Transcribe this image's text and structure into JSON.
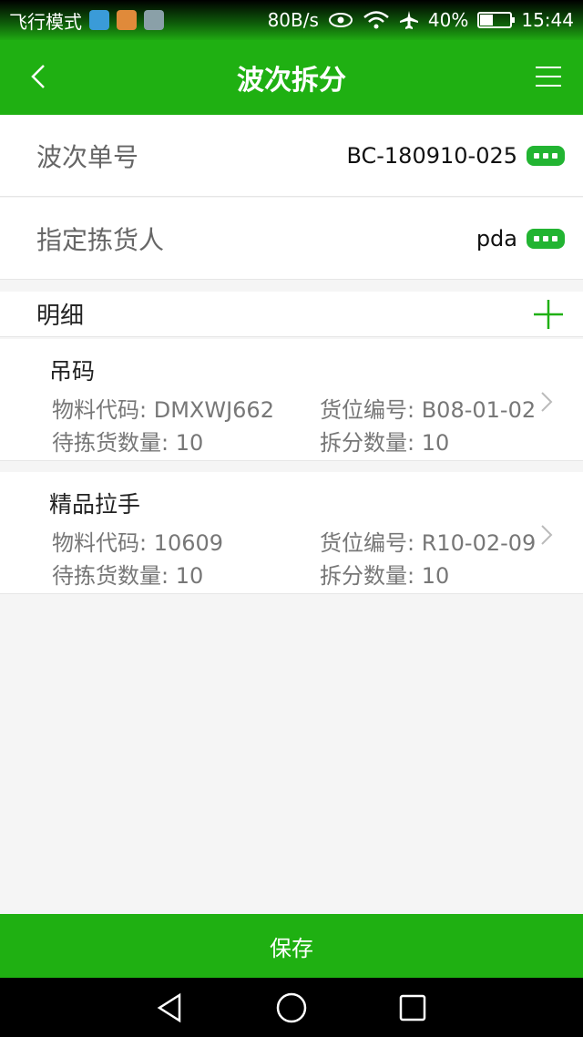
{
  "status_bar": {
    "left_text": "飞行模式",
    "speed": "80B/s",
    "battery": "40%",
    "time": "15:44",
    "icons": [
      "health-icon",
      "mail-icon",
      "gallery-icon",
      "eye-icon",
      "wifi-icon",
      "airplane-icon",
      "battery-icon"
    ]
  },
  "app_bar": {
    "title": "波次拆分",
    "back_icon": "chevron-left-icon",
    "menu_icon": "hamburger-menu-icon"
  },
  "fields": [
    {
      "label": "波次单号",
      "value": "BC-180910-025"
    },
    {
      "label": "指定拣货人",
      "value": "pda"
    }
  ],
  "detail": {
    "title": "明细",
    "add_icon": "plus-icon"
  },
  "items": [
    {
      "name": "吊码",
      "material_code": "物料代码: DMXWJ662",
      "location": "货位编号: B08-01-02",
      "pending_qty": "待拣货数量: 10",
      "split_qty": "拆分数量: 10"
    },
    {
      "name": "精品拉手",
      "material_code": "物料代码: 10609",
      "location": "货位编号: R10-02-09",
      "pending_qty": "待拣货数量: 10",
      "split_qty": "拆分数量: 10"
    }
  ],
  "save_label": "保存",
  "colors": {
    "primary_green": "#1fb012",
    "badge_green": "#22b432",
    "background": "#f5f5f5"
  }
}
